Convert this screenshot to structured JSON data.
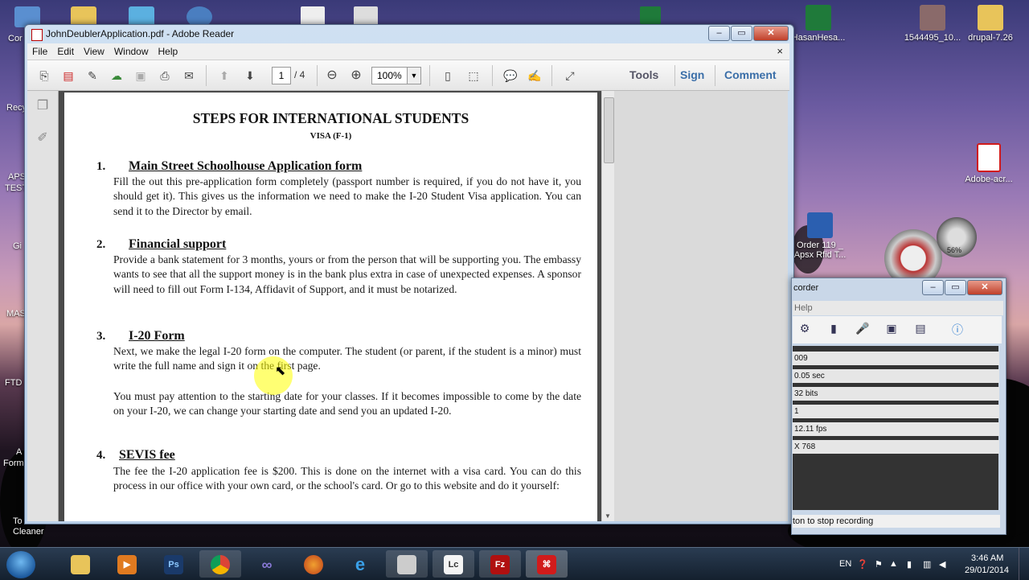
{
  "desktop": {
    "icons": [
      {
        "label": "HasanHesa..."
      },
      {
        "label": "1544495_10..."
      },
      {
        "label": "drupal-7.26"
      },
      {
        "label": "Adobe-acr..."
      },
      {
        "label": "Order 119 _ Apsx Rfid T..."
      }
    ],
    "left_fragments": [
      "Cor",
      "Recy",
      "APS",
      "TEST",
      "Gi",
      "MAS",
      "FTD",
      "A",
      "Form",
      "To",
      "Cleaner"
    ],
    "gauge_text": "56%"
  },
  "reader": {
    "title": "JohnDeublerApplication.pdf - Adobe Reader",
    "menu": [
      "File",
      "Edit",
      "View",
      "Window",
      "Help"
    ],
    "menu_close": "×",
    "page_current": "1",
    "page_total": "/ 4",
    "zoom": "100%",
    "right_tools": {
      "tools": "Tools",
      "sign": "Sign",
      "comment": "Comment"
    }
  },
  "document": {
    "title": "STEPS FOR INTERNATIONAL STUDENTS",
    "subtitle": "VISA (F-1)",
    "sections": [
      {
        "num": "1.",
        "heading": "Main Street Schoolhouse Application form",
        "body": "Fill the out this pre-application form completely (passport number is required, if you do not have it, you should get it). This gives us the information we need to make the I-20 Student Visa application.  You can send it to the Director by email."
      },
      {
        "num": "2.",
        "heading": "Financial support",
        "body": "Provide a bank statement for 3 months, yours or from the person that will be supporting you. The embassy wants to see that all the support money is in the bank plus extra in case of unexpected expenses.  A sponsor will need to fill out Form I-134, Affidavit of Support, and it must be notarized."
      },
      {
        "num": "3.",
        "heading": "I-20 Form",
        "body": "Next, we make the legal I-20 form on the computer.   The student (or parent, if the student is a minor) must write the full name and sign it on the first page.",
        "body2": "You must pay attention to the starting date for your classes. If it becomes impossible to come by the date on your I-20, we can change your starting date and send you an updated I-20."
      },
      {
        "num": "4.",
        "heading": "SEVIS fee",
        "body": "The fee the I-20 application fee is $200. This is done on the internet with a visa card. You can do this process in our office with your own card, or the school's card.  Or go to this website and do it yourself:"
      }
    ]
  },
  "recorder": {
    "title": "corder",
    "menu": "Help",
    "stats": [
      "009",
      "0.05 sec",
      "32 bits",
      "1",
      "12.11 fps",
      "X 768"
    ],
    "status": "ton to stop recording"
  },
  "taskbar": {
    "apps": [
      "Ps",
      "Lc",
      "Fz"
    ],
    "lang": "EN",
    "time": "3:46 AM",
    "date": "29/01/2014"
  },
  "colors": {
    "accent": "#1d5a9e",
    "pdf_red": "#d11b1b"
  }
}
